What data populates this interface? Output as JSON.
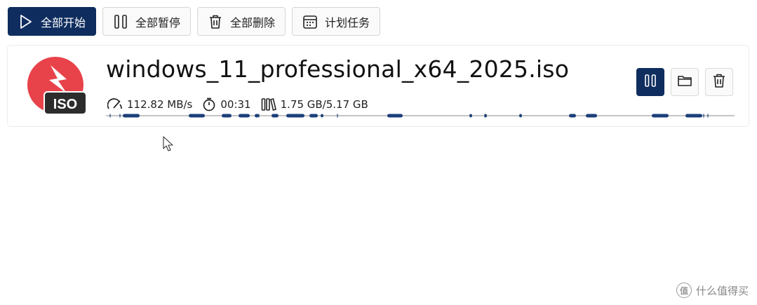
{
  "toolbar": {
    "start_all": "全部开始",
    "pause_all": "全部暂停",
    "delete_all": "全部删除",
    "schedule": "计划任务"
  },
  "download": {
    "filename": "windows_11_professional_x64_2025.iso",
    "icon_label": "ISO",
    "speed": "112.82 MB/s",
    "elapsed": "00:31",
    "size": "1.75 GB/5.17 GB",
    "progress_fraction": 0.338,
    "state": "downloading"
  },
  "watermark": {
    "badge": "值",
    "text": "什么值得买"
  },
  "colors": {
    "primary": "#0f2d5e",
    "icon_red": "#e8434a",
    "segment": "#1c3f7a"
  }
}
